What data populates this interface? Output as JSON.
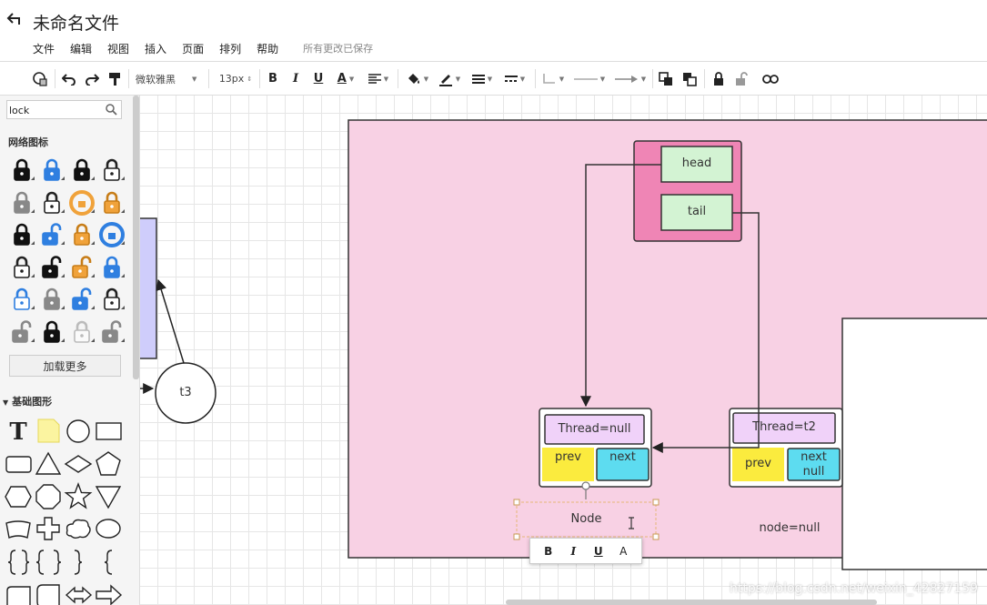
{
  "app": {
    "back_icon": "back-arrow-icon",
    "title": "未命名文件",
    "menu": [
      "文件",
      "编辑",
      "视图",
      "插入",
      "页面",
      "排列",
      "帮助"
    ],
    "save_status": "所有更改已保存"
  },
  "toolbar": {
    "font": "微软雅黑",
    "font_size": "13px",
    "bold": "B",
    "italic": "I",
    "underline": "U",
    "font_color": "A"
  },
  "sidebar": {
    "search_value": "lock",
    "network_section": "网络图标",
    "load_more": "加载更多",
    "basic_section": "基础图形",
    "lock_icons": [
      "lock-black",
      "lock-blue",
      "lock-black",
      "lock-outline",
      "lock-gray",
      "lock-outline",
      "lock-orange-round",
      "lock-orange",
      "lock-black",
      "unlock-blue",
      "lock-orange",
      "lock-blue-round",
      "lock-outline",
      "unlock-black",
      "unlock-orange",
      "lock-blue",
      "lock-outline-blue",
      "lock-gray",
      "unlock-blue",
      "lock-outline",
      "unlock-gray",
      "lock-black",
      "lock-outline-light",
      "unlock-gray"
    ],
    "shape_icons": [
      "text-shape",
      "note-shape",
      "circle-shape",
      "rectangle-shape",
      "rounded-rectangle-shape",
      "triangle-shape",
      "diamond-shape",
      "pentagon-shape",
      "hexagon-shape",
      "octagon-shape",
      "star-shape",
      "inverted-triangle-shape",
      "callout-shape",
      "cross-shape",
      "cloud-shape",
      "speech-bubble-shape",
      "brace-left-shape",
      "braces-pair-shape",
      "brace-right-shape",
      "brace-single-shape",
      "document-shape",
      "card-shape",
      "double-arrow-shape",
      "right-arrow-shape"
    ]
  },
  "canvas": {
    "circle_label": "t3",
    "head_label": "head",
    "tail_label": "tail",
    "node1": {
      "thread": "Thread=null",
      "prev": "prev",
      "next": "next"
    },
    "node2": {
      "thread": "Thread=t2",
      "prev": "prev",
      "next_line1": "next",
      "next_line2": "null"
    },
    "selected_text": "Node",
    "node_null": "node=null",
    "text_toolbar": {
      "bold": "B",
      "italic": "I",
      "underline": "U",
      "color": "A"
    },
    "watermark": "https://blog.csdn.net/weixin_42827159"
  },
  "colors": {
    "container_pink": "#f8d1e4",
    "queue_pink": "#ef85b5",
    "head_green": "#d3f3d3",
    "thread_purple": "#f0d2f9",
    "prev_yellow": "#fbeb3e",
    "next_cyan": "#5ddcf0",
    "left_block_lavender": "#cfcdfb"
  }
}
